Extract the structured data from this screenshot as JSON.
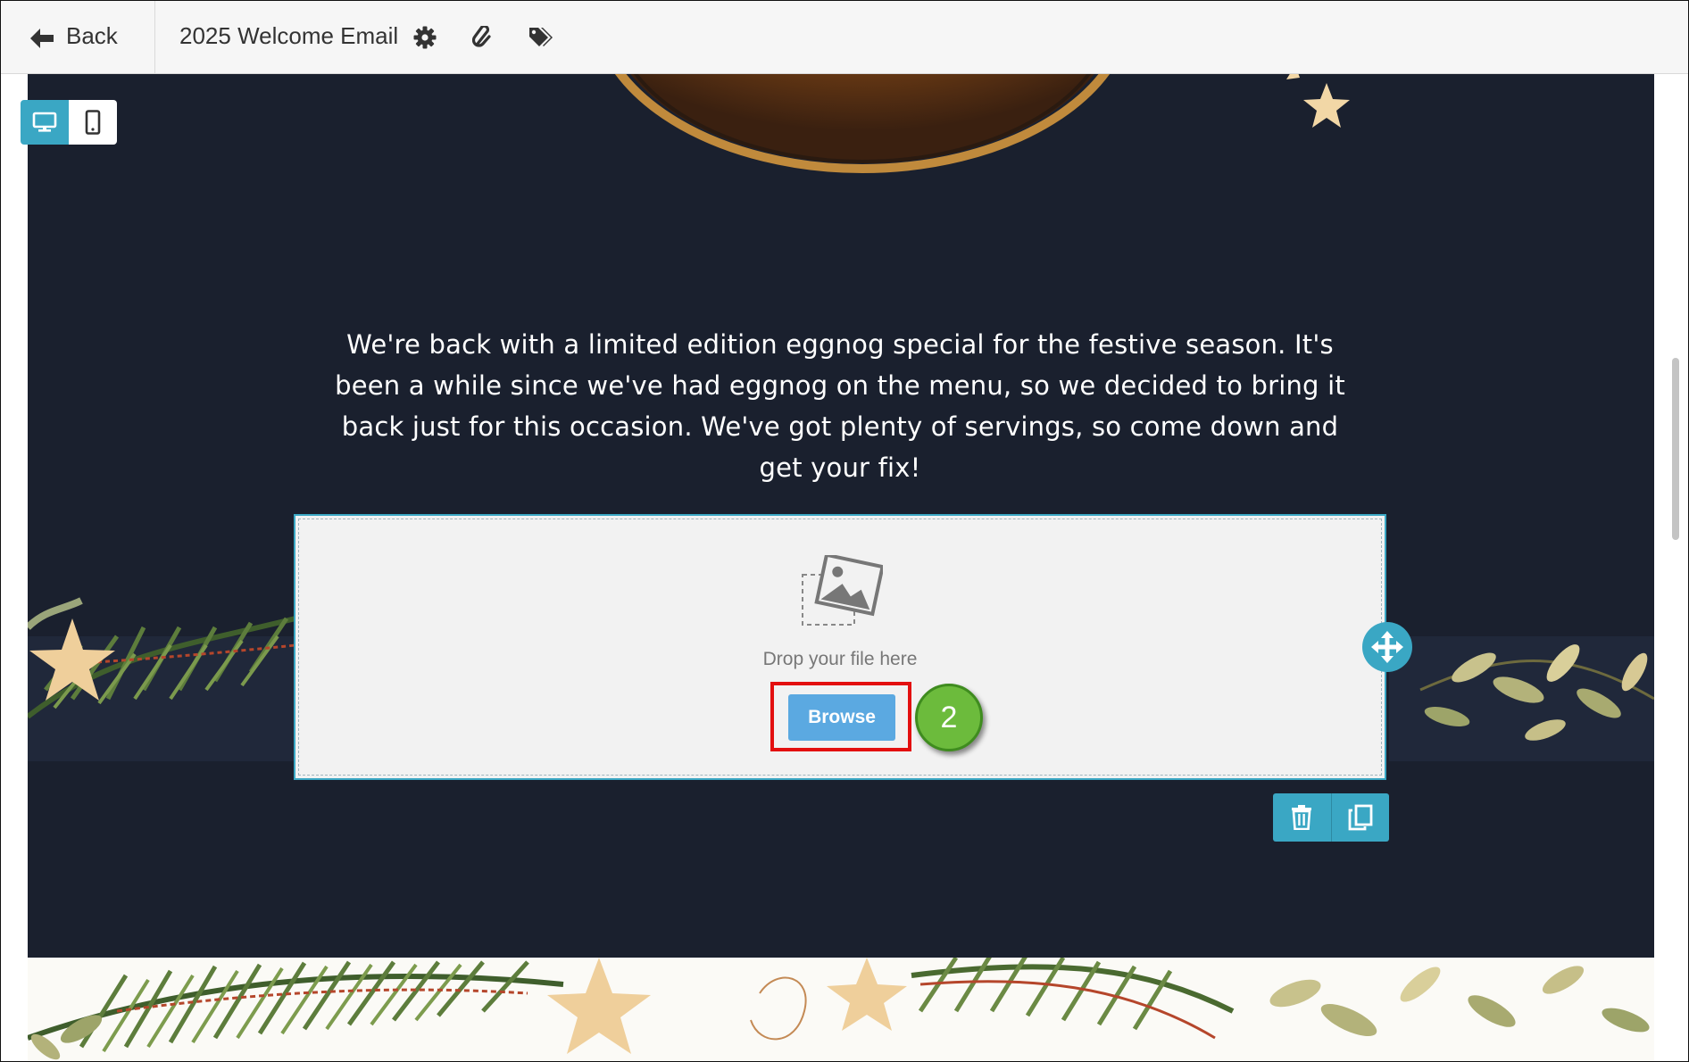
{
  "topbar": {
    "back_label": "Back",
    "email_title": "2025 Welcome Email",
    "icons": [
      "gear-icon",
      "paperclip-icon",
      "tags-icon"
    ]
  },
  "view_toggle": {
    "options": [
      "desktop",
      "mobile"
    ],
    "selected": "desktop"
  },
  "email_body": {
    "paragraph": "We're back with a limited edition eggnog special for the festive season. It's been a while since we've had eggnog on the menu, so we decided to bring it back just for this occasion. We've got plenty of servings, so come down and get your fix!"
  },
  "image_block": {
    "drop_text": "Drop your file here",
    "browse_label": "Browse"
  },
  "annotation": {
    "step_number": "2"
  },
  "colors": {
    "accent": "#3aa7c4",
    "canvas_bg": "#1a202e",
    "browse_button": "#5ba9e1",
    "highlight_red": "#e31010",
    "step_green": "#6cbb3c"
  }
}
